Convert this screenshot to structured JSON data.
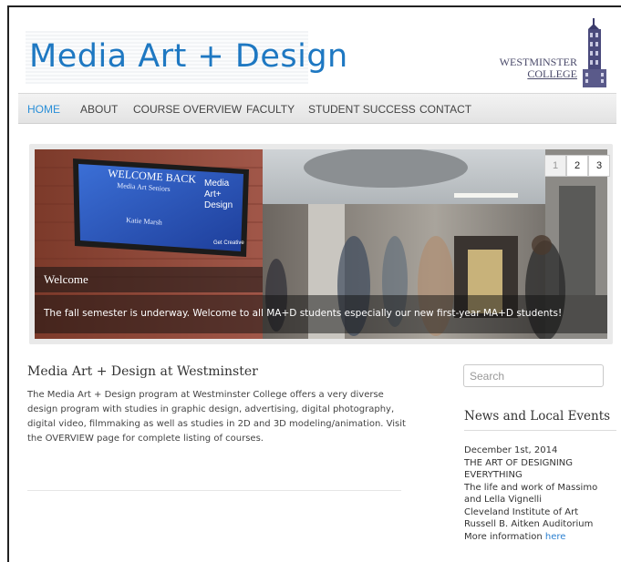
{
  "header": {
    "logo_text": "Media Art + Design",
    "college_line1": "WESTMINSTER",
    "college_line2": "COLLEGE"
  },
  "nav": {
    "items": [
      {
        "label": "HOME",
        "active": true
      },
      {
        "label": "ABOUT"
      },
      {
        "label": "COURSE OVERVIEW"
      },
      {
        "label": "FACULTY"
      },
      {
        "label": "STUDENT SUCCESS"
      },
      {
        "label": "CONTACT"
      }
    ]
  },
  "slider": {
    "pages": [
      "1",
      "2",
      "3"
    ],
    "current_page": 1,
    "caption_title": "Welcome",
    "caption_text": "The fall semester is underway. Welcome to all MA+D students especially our new first-year MA+D students!",
    "screen_lines": [
      "WELCOME BACK",
      "Media Art Seniors",
      "Katie Marsh",
      "Media",
      "Art+",
      "Design",
      "Get Creative"
    ]
  },
  "main": {
    "title": "Media Art + Design at Westminster",
    "body": "The Media Art + Design program at Westminster College offers a very diverse design program with studies in graphic design, advertising, digital photography, digital video, filmmaking as well as studies in 2D and 3D modeling/animation. Visit the OVERVIEW page for complete listing of courses."
  },
  "sidebar": {
    "search_placeholder": "Search",
    "news_title": "News and Local Events",
    "event": {
      "date": "December 1st, 2014",
      "title_line1": "THE ART OF DESIGNING",
      "title_line2": "EVERYTHING",
      "desc_line1": "The life and work of Massimo",
      "desc_line2": "and Lella Vignelli",
      "venue": "Cleveland Institute of Art",
      "location": "Russell B. Aitken Auditorium",
      "more_prefix": "More information",
      "more_link": "here"
    }
  },
  "colors": {
    "accent": "#2a8fd8",
    "logo": "#1e78c2"
  }
}
